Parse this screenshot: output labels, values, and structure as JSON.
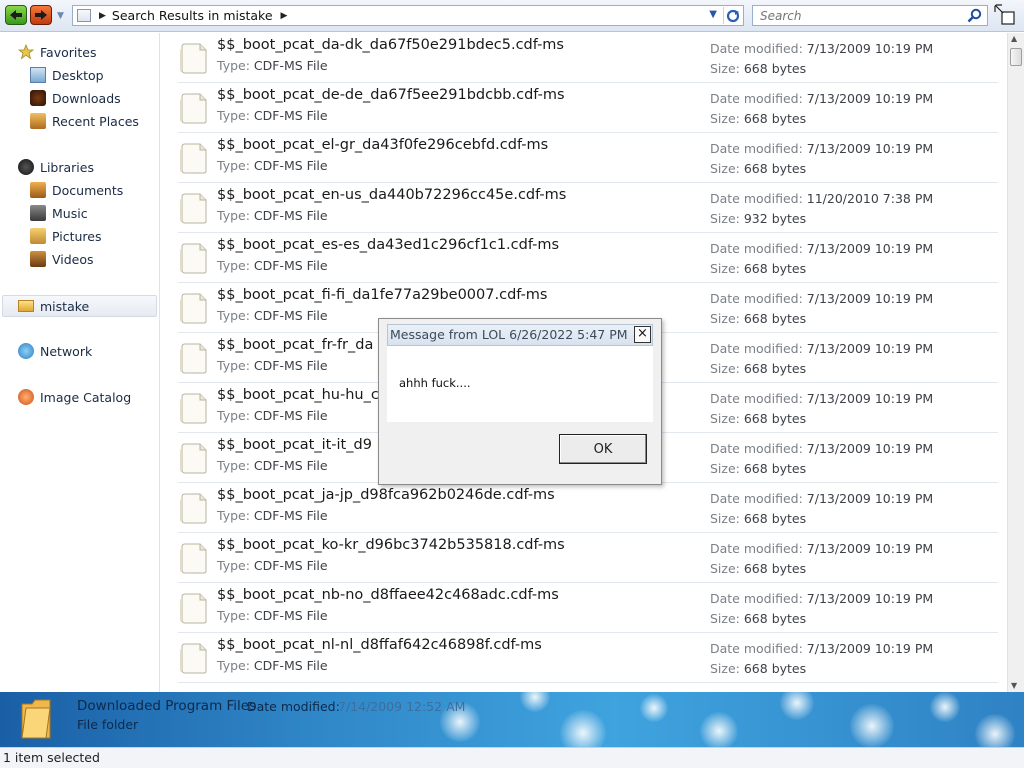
{
  "address_bar": {
    "path_text": "Search Results in mistake"
  },
  "search": {
    "placeholder": "Search"
  },
  "sidebar": {
    "favorites": {
      "label": "Favorites",
      "items": [
        "Desktop",
        "Downloads",
        "Recent Places"
      ]
    },
    "libraries": {
      "label": "Libraries",
      "items": [
        "Documents",
        "Music",
        "Pictures",
        "Videos"
      ]
    },
    "folder": "mistake",
    "network": "Network",
    "catalog": "Image Catalog"
  },
  "labels": {
    "type": "Type:",
    "date_modified": "Date modified:",
    "size": "Size:"
  },
  "files": [
    {
      "name": "$$_boot_pcat_da-dk_da67f50e291bdec5.cdf-ms",
      "type": "CDF-MS File",
      "date": "7/13/2009 10:19 PM",
      "size": "668 bytes"
    },
    {
      "name": "$$_boot_pcat_de-de_da67f5ee291bdcbb.cdf-ms",
      "type": "CDF-MS File",
      "date": "7/13/2009 10:19 PM",
      "size": "668 bytes"
    },
    {
      "name": "$$_boot_pcat_el-gr_da43f0fe296cebfd.cdf-ms",
      "type": "CDF-MS File",
      "date": "7/13/2009 10:19 PM",
      "size": "668 bytes"
    },
    {
      "name": "$$_boot_pcat_en-us_da440b72296cc45e.cdf-ms",
      "type": "CDF-MS File",
      "date": "11/20/2010 7:38 PM",
      "size": "932 bytes"
    },
    {
      "name": "$$_boot_pcat_es-es_da43ed1c296cf1c1.cdf-ms",
      "type": "CDF-MS File",
      "date": "7/13/2009 10:19 PM",
      "size": "668 bytes"
    },
    {
      "name": "$$_boot_pcat_fi-fi_da1fe77a29be0007.cdf-ms",
      "type": "CDF-MS File",
      "date": "7/13/2009 10:19 PM",
      "size": "668 bytes"
    },
    {
      "name": "$$_boot_pcat_fr-fr_da",
      "type": "CDF-MS File",
      "date": "7/13/2009 10:19 PM",
      "size": "668 bytes"
    },
    {
      "name": "$$_boot_pcat_hu-hu_c",
      "type": "CDF-MS File",
      "date": "7/13/2009 10:19 PM",
      "size": "668 bytes"
    },
    {
      "name": "$$_boot_pcat_it-it_d9",
      "type": "CDF-MS File",
      "date": "7/13/2009 10:19 PM",
      "size": "668 bytes"
    },
    {
      "name": "$$_boot_pcat_ja-jp_d98fca962b0246de.cdf-ms",
      "type": "CDF-MS File",
      "date": "7/13/2009 10:19 PM",
      "size": "668 bytes"
    },
    {
      "name": "$$_boot_pcat_ko-kr_d96bc3742b535818.cdf-ms",
      "type": "CDF-MS File",
      "date": "7/13/2009 10:19 PM",
      "size": "668 bytes"
    },
    {
      "name": "$$_boot_pcat_nb-no_d8ffaee42c468adc.cdf-ms",
      "type": "CDF-MS File",
      "date": "7/13/2009 10:19 PM",
      "size": "668 bytes"
    },
    {
      "name": "$$_boot_pcat_nl-nl_d8ffaf642c46898f.cdf-ms",
      "type": "CDF-MS File",
      "date": "7/13/2009 10:19 PM",
      "size": "668 bytes"
    }
  ],
  "details_pane": {
    "name": "Downloaded Program Files",
    "date_label": "Date modified:",
    "date_value": "7/14/2009 12:52 AM",
    "type": "File folder"
  },
  "status_bar": {
    "text": "1 item selected"
  },
  "message_box": {
    "title": "Message from LOL 6/26/2022 5:47 PM",
    "close_label": "×",
    "body": "ahhh fuck....",
    "ok_label": "OK"
  },
  "colors": {
    "details_pane_bg": "#2f86c7",
    "back_button": "#3a9a18",
    "forward_button": "#c23a10"
  }
}
